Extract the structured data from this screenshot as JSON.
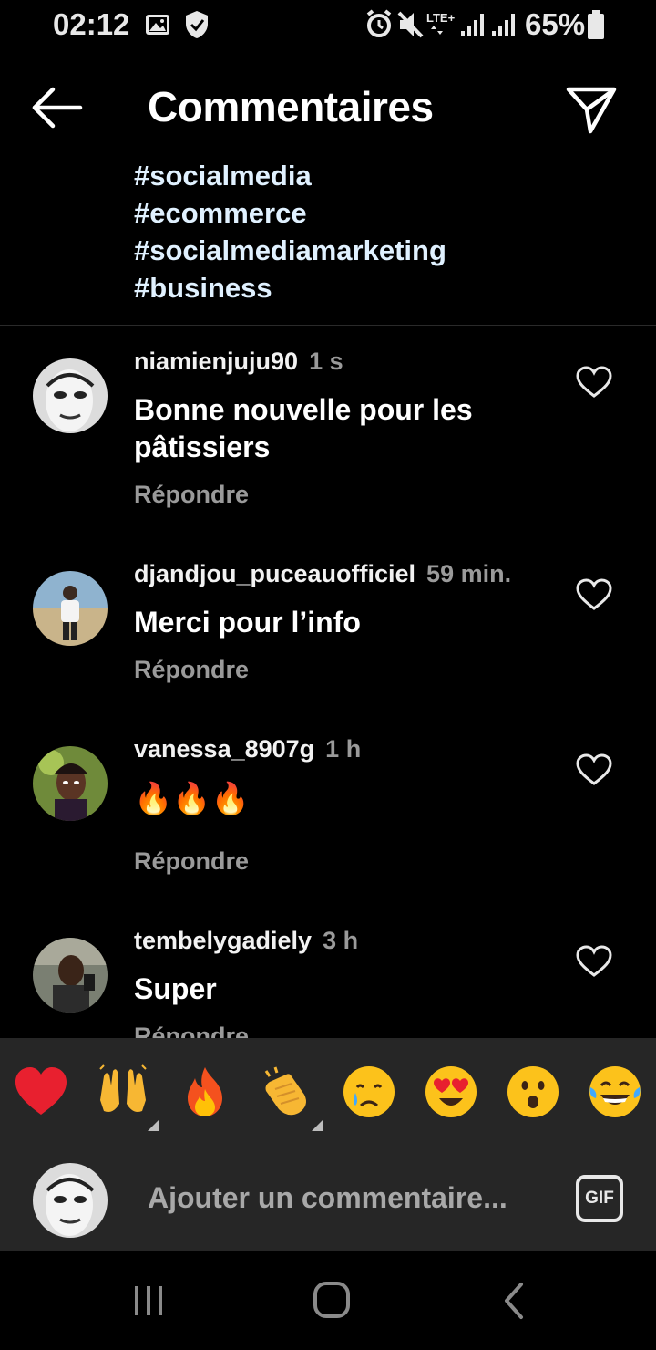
{
  "status_bar": {
    "time": "02:12",
    "battery_percent": "65%",
    "network_label": "LTE+",
    "icons": [
      "image-icon",
      "shield-icon",
      "alarm-icon",
      "mute-icon",
      "lte-icon",
      "signal-icon",
      "signal-icon",
      "battery-icon"
    ]
  },
  "header": {
    "title": "Commentaires",
    "back_icon": "arrow-left-icon",
    "send_icon": "paper-plane-icon"
  },
  "caption": {
    "hashtags": [
      "#socialmedia",
      "#ecommerce",
      "#socialmediamarketing",
      "#business"
    ]
  },
  "comments": [
    {
      "username": "niamienjuju90",
      "time": "1 s",
      "text": "Bonne nouvelle pour les pâtissiers",
      "reply_label": "Répondre"
    },
    {
      "username": "djandjou_puceauofficiel",
      "time": "59 min.",
      "text": "Merci pour l’info",
      "reply_label": "Répondre"
    },
    {
      "username": "vanessa_8907g",
      "time": "1 h",
      "text": "🔥🔥🔥",
      "reply_label": "Répondre"
    },
    {
      "username": "tembelygadiely",
      "time": "3 h",
      "text": "Super",
      "reply_label": "Répondre"
    }
  ],
  "emoji_bar": {
    "emojis": [
      "❤️",
      "🙌",
      "🔥",
      "👏",
      "😢",
      "😍",
      "😮",
      "😂"
    ]
  },
  "composer": {
    "placeholder": "Ajouter un commentaire...",
    "gif_label": "GIF"
  },
  "nav_bar": {
    "icons": [
      "recent-apps-icon",
      "home-icon",
      "back-icon"
    ]
  },
  "colors": {
    "background": "#000000",
    "hashtag": "#e0f1ff",
    "secondary_text": "#9a9a9a",
    "panel": "#262626"
  }
}
